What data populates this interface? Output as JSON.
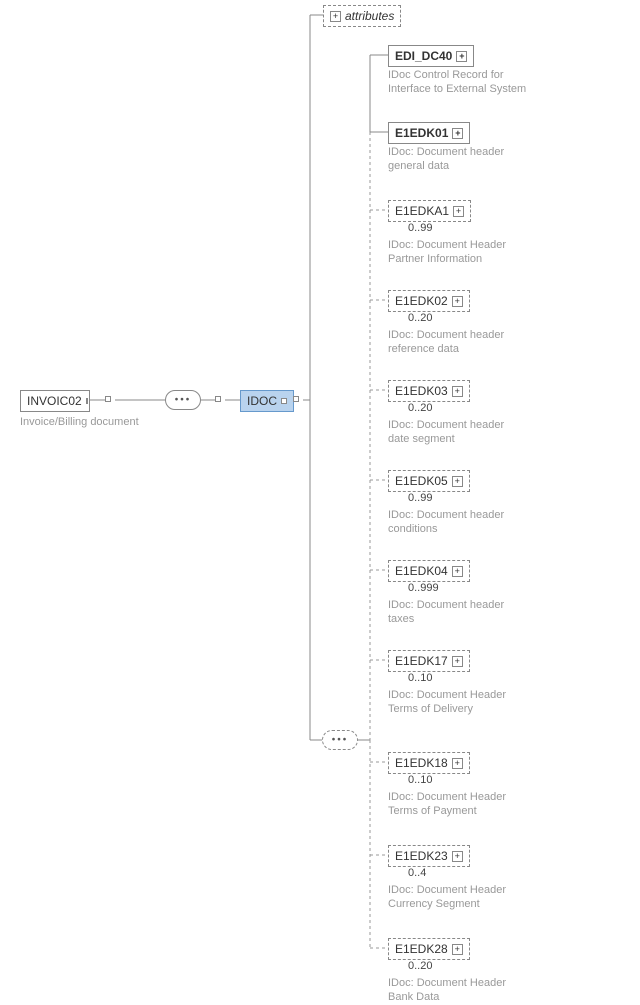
{
  "root": {
    "name": "INVOIC02",
    "desc": "Invoice/Billing document"
  },
  "idoc": {
    "name": "IDOC"
  },
  "attributes_label": "attributes",
  "children": [
    {
      "name": "EDI_DC40",
      "desc": "IDoc Control Record for Interface to External System",
      "card": "",
      "dashed": false
    },
    {
      "name": "E1EDK01",
      "desc": "IDoc: Document header general data",
      "card": "",
      "dashed": false
    },
    {
      "name": "E1EDKA1",
      "desc": "IDoc: Document Header Partner Information",
      "card": "0..99",
      "dashed": true
    },
    {
      "name": "E1EDK02",
      "desc": "IDoc: Document header reference data",
      "card": "0..20",
      "dashed": true
    },
    {
      "name": "E1EDK03",
      "desc": "IDoc: Document header date segment",
      "card": "0..20",
      "dashed": true
    },
    {
      "name": "E1EDK05",
      "desc": "IDoc: Document header conditions",
      "card": "0..99",
      "dashed": true
    },
    {
      "name": "E1EDK04",
      "desc": "IDoc: Document header taxes",
      "card": "0..999",
      "dashed": true
    },
    {
      "name": "E1EDK17",
      "desc": "IDoc: Document Header Terms of Delivery",
      "card": "0..10",
      "dashed": true
    },
    {
      "name": "E1EDK18",
      "desc": "IDoc: Document Header Terms of Payment",
      "card": "0..10",
      "dashed": true
    },
    {
      "name": "E1EDK23",
      "desc": "IDoc: Document Header Currency Segment",
      "card": "0..4",
      "dashed": true
    },
    {
      "name": "E1EDK28",
      "desc": "IDoc: Document Header Bank Data",
      "card": "0..20",
      "dashed": true
    }
  ]
}
